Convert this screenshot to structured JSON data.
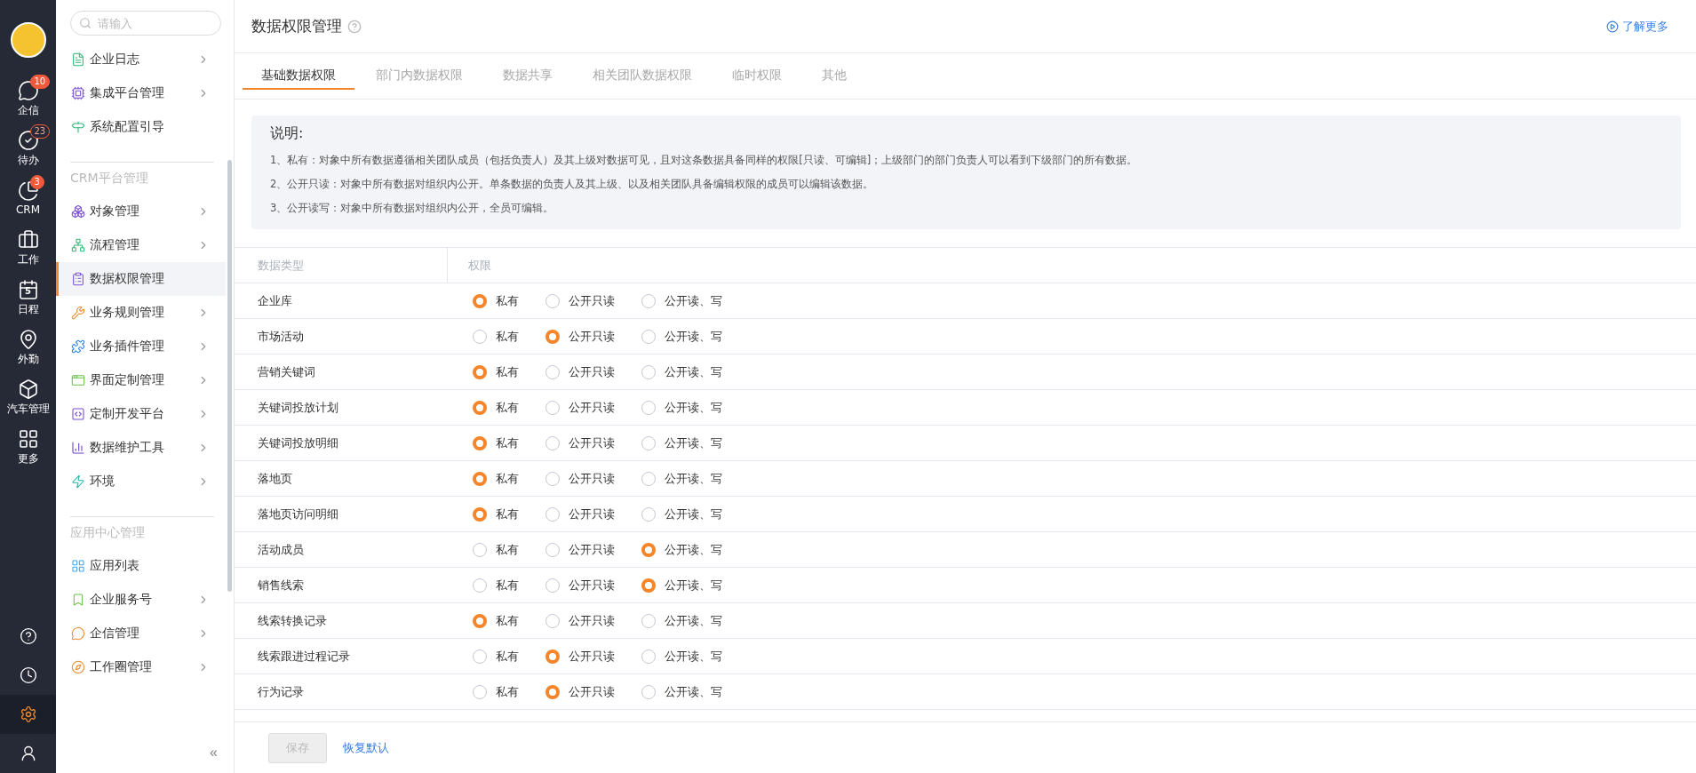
{
  "rail": {
    "top": [
      {
        "kind": "chat",
        "label": "企信",
        "badge": "10",
        "outlined": false
      },
      {
        "kind": "todo",
        "label": "待办",
        "badge": "23",
        "outlined": true
      },
      {
        "kind": "pie",
        "label": "CRM",
        "badge": "3",
        "outlined": false
      },
      {
        "kind": "work",
        "label": "工作"
      },
      {
        "kind": "calendar",
        "label": "日程",
        "icon_text": "5"
      },
      {
        "kind": "pin",
        "label": "外勤"
      },
      {
        "kind": "box",
        "label": "汽车管理"
      },
      {
        "kind": "grid",
        "label": "更多"
      }
    ],
    "bottom": [
      {
        "kind": "help",
        "selected": false
      },
      {
        "kind": "clock",
        "selected": false
      },
      {
        "kind": "settings",
        "selected": true
      },
      {
        "kind": "user",
        "selected": false
      }
    ]
  },
  "nav": {
    "search": {
      "placeholder": "请输入"
    },
    "sections": [
      {
        "items": [
          {
            "label": "企业日志",
            "kind": "log",
            "arrow": true,
            "selected": false
          },
          {
            "label": "集成平台管理",
            "kind": "chip",
            "arrow": true,
            "selected": false
          },
          {
            "label": "系统配置引导",
            "kind": "guide",
            "arrow": false,
            "selected": false
          }
        ]
      },
      {
        "title": "CRM平台管理",
        "items": [
          {
            "label": "对象管理",
            "kind": "object",
            "arrow": true,
            "selected": false
          },
          {
            "label": "流程管理",
            "kind": "flow",
            "arrow": true,
            "selected": false
          },
          {
            "label": "数据权限管理",
            "kind": "perm",
            "arrow": false,
            "selected": true
          },
          {
            "label": "业务规则管理",
            "kind": "rule",
            "arrow": true,
            "selected": false
          },
          {
            "label": "业务插件管理",
            "kind": "plugin",
            "arrow": true,
            "selected": false
          },
          {
            "label": "界面定制管理",
            "kind": "ui",
            "arrow": true,
            "selected": false
          },
          {
            "label": "定制开发平台",
            "kind": "code",
            "arrow": true,
            "selected": false
          },
          {
            "label": "数据维护工具",
            "kind": "chart",
            "arrow": true,
            "selected": false
          },
          {
            "label": "环境",
            "kind": "env",
            "arrow": true,
            "selected": false
          }
        ]
      },
      {
        "title": "应用中心管理",
        "items": [
          {
            "label": "应用列表",
            "kind": "apps",
            "arrow": false,
            "selected": false
          },
          {
            "label": "企业服务号",
            "kind": "service",
            "arrow": true,
            "selected": false
          },
          {
            "label": "企信管理",
            "kind": "msg",
            "arrow": true,
            "selected": false
          },
          {
            "label": "工作圈管理",
            "kind": "circle",
            "arrow": true,
            "selected": false
          }
        ]
      }
    ],
    "collapse": "«"
  },
  "header": {
    "title": "数据权限管理",
    "link": "了解更多"
  },
  "tabs": [
    {
      "label": "基础数据权限",
      "selected": true
    },
    {
      "label": "部门内数据权限",
      "selected": false
    },
    {
      "label": "数据共享",
      "selected": false
    },
    {
      "label": "相关团队数据权限",
      "selected": false
    },
    {
      "label": "临时权限",
      "selected": false
    },
    {
      "label": "其他",
      "selected": false
    }
  ],
  "notice": {
    "title": "说明:",
    "lines": [
      "1、私有：对象中所有数据遵循相关团队成员（包括负责人）及其上级对数据可见，且对这条数据具备同样的权限[只读、可编辑]；上级部门的部门负责人可以看到下级部门的所有数据。",
      "2、公开只读：对象中所有数据对组织内公开。单条数据的负责人及其上级、以及相关团队具备编辑权限的成员可以编辑该数据。",
      "3、公开读写：对象中所有数据对组织内公开，全员可编辑。"
    ]
  },
  "table": {
    "columns": [
      "数据类型",
      "权限"
    ],
    "rows": [
      {
        "type": "企业库",
        "options": [
          {
            "label": "私有",
            "selected": true
          },
          {
            "label": "公开只读",
            "selected": false
          },
          {
            "label": "公开读、写",
            "selected": false
          }
        ]
      },
      {
        "type": "市场活动",
        "options": [
          {
            "label": "私有",
            "selected": false
          },
          {
            "label": "公开只读",
            "selected": true
          },
          {
            "label": "公开读、写",
            "selected": false
          }
        ]
      },
      {
        "type": "营销关键词",
        "options": [
          {
            "label": "私有",
            "selected": true
          },
          {
            "label": "公开只读",
            "selected": false
          },
          {
            "label": "公开读、写",
            "selected": false
          }
        ]
      },
      {
        "type": "关键词投放计划",
        "options": [
          {
            "label": "私有",
            "selected": true
          },
          {
            "label": "公开只读",
            "selected": false
          },
          {
            "label": "公开读、写",
            "selected": false
          }
        ]
      },
      {
        "type": "关键词投放明细",
        "options": [
          {
            "label": "私有",
            "selected": true
          },
          {
            "label": "公开只读",
            "selected": false
          },
          {
            "label": "公开读、写",
            "selected": false
          }
        ]
      },
      {
        "type": "落地页",
        "options": [
          {
            "label": "私有",
            "selected": true
          },
          {
            "label": "公开只读",
            "selected": false
          },
          {
            "label": "公开读、写",
            "selected": false
          }
        ]
      },
      {
        "type": "落地页访问明细",
        "options": [
          {
            "label": "私有",
            "selected": true
          },
          {
            "label": "公开只读",
            "selected": false
          },
          {
            "label": "公开读、写",
            "selected": false
          }
        ]
      },
      {
        "type": "活动成员",
        "options": [
          {
            "label": "私有",
            "selected": false
          },
          {
            "label": "公开只读",
            "selected": false
          },
          {
            "label": "公开读、写",
            "selected": true
          }
        ]
      },
      {
        "type": "销售线索",
        "options": [
          {
            "label": "私有",
            "selected": false
          },
          {
            "label": "公开只读",
            "selected": false
          },
          {
            "label": "公开读、写",
            "selected": true
          }
        ]
      },
      {
        "type": "线索转换记录",
        "options": [
          {
            "label": "私有",
            "selected": true
          },
          {
            "label": "公开只读",
            "selected": false
          },
          {
            "label": "公开读、写",
            "selected": false
          }
        ]
      },
      {
        "type": "线索跟进过程记录",
        "options": [
          {
            "label": "私有",
            "selected": false
          },
          {
            "label": "公开只读",
            "selected": true
          },
          {
            "label": "公开读、写",
            "selected": false
          }
        ]
      },
      {
        "type": "行为记录",
        "options": [
          {
            "label": "私有",
            "selected": false
          },
          {
            "label": "公开只读",
            "selected": true
          },
          {
            "label": "公开读、写",
            "selected": false
          }
        ]
      }
    ]
  },
  "footer": {
    "save": {
      "label": "保存",
      "disabled": true
    },
    "reset": "恢复默认"
  }
}
